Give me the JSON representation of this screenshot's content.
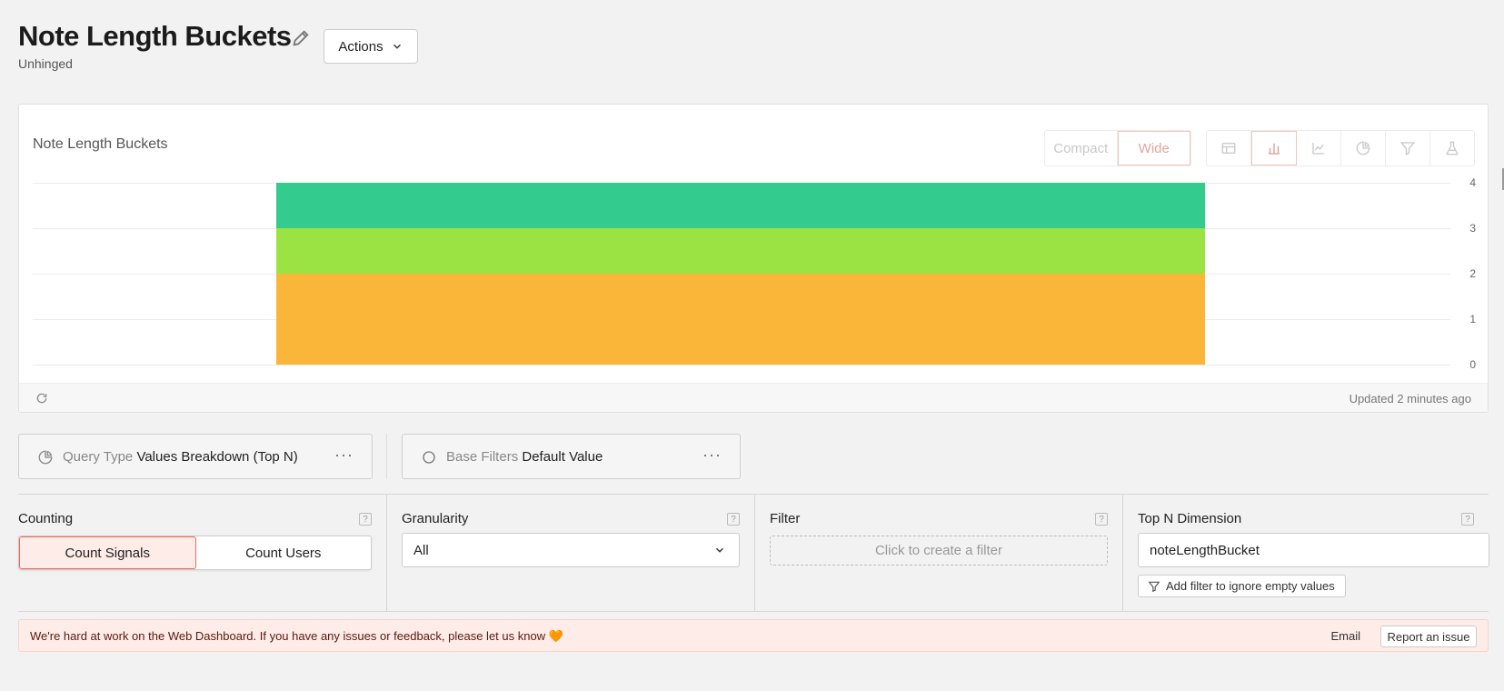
{
  "header": {
    "title": "Note Length Buckets",
    "subtitle": "Unhinged",
    "actions_label": "Actions"
  },
  "chart_card": {
    "title": "Note Length Buckets",
    "layout_options": [
      "Compact",
      "Wide"
    ],
    "active_layout": "Wide",
    "type_icons": [
      "table-icon",
      "bar-chart-icon",
      "line-chart-icon",
      "pie-chart-icon",
      "funnel-icon",
      "experiment-icon"
    ],
    "active_type": "bar-chart-icon",
    "updated_text": "Updated 2 minutes ago"
  },
  "chart_data": {
    "type": "bar",
    "stacked": true,
    "categories": [
      ""
    ],
    "series": [
      {
        "values": [
          2
        ],
        "color": "#fab638"
      },
      {
        "values": [
          1
        ],
        "color": "#9be243"
      },
      {
        "values": [
          1
        ],
        "color": "#34cb8f"
      }
    ],
    "ylim": [
      0,
      4
    ],
    "yticks": [
      "4",
      "3",
      "2",
      "1",
      "0"
    ],
    "grid": true
  },
  "query_type": {
    "label": "Query Type",
    "value": "Values Breakdown (Top N)"
  },
  "base_filters": {
    "label": "Base Filters",
    "value": "Default Value"
  },
  "counting": {
    "label": "Counting",
    "options": [
      "Count Signals",
      "Count Users"
    ],
    "active": "Count Signals"
  },
  "granularity": {
    "label": "Granularity",
    "value": "All"
  },
  "filter": {
    "label": "Filter",
    "placeholder": "Click to create a filter"
  },
  "top_n": {
    "label": "Top N Dimension",
    "value": "noteLengthBucket",
    "ignore_empty_label": "Add filter to ignore empty values"
  },
  "banner": {
    "message": "We're hard at work on the Web Dashboard. If you have any issues or feedback, please let us know 🧡",
    "email_label": "Email",
    "report_label": "Report an issue"
  },
  "help_glyph": "?",
  "more_glyph": "···"
}
